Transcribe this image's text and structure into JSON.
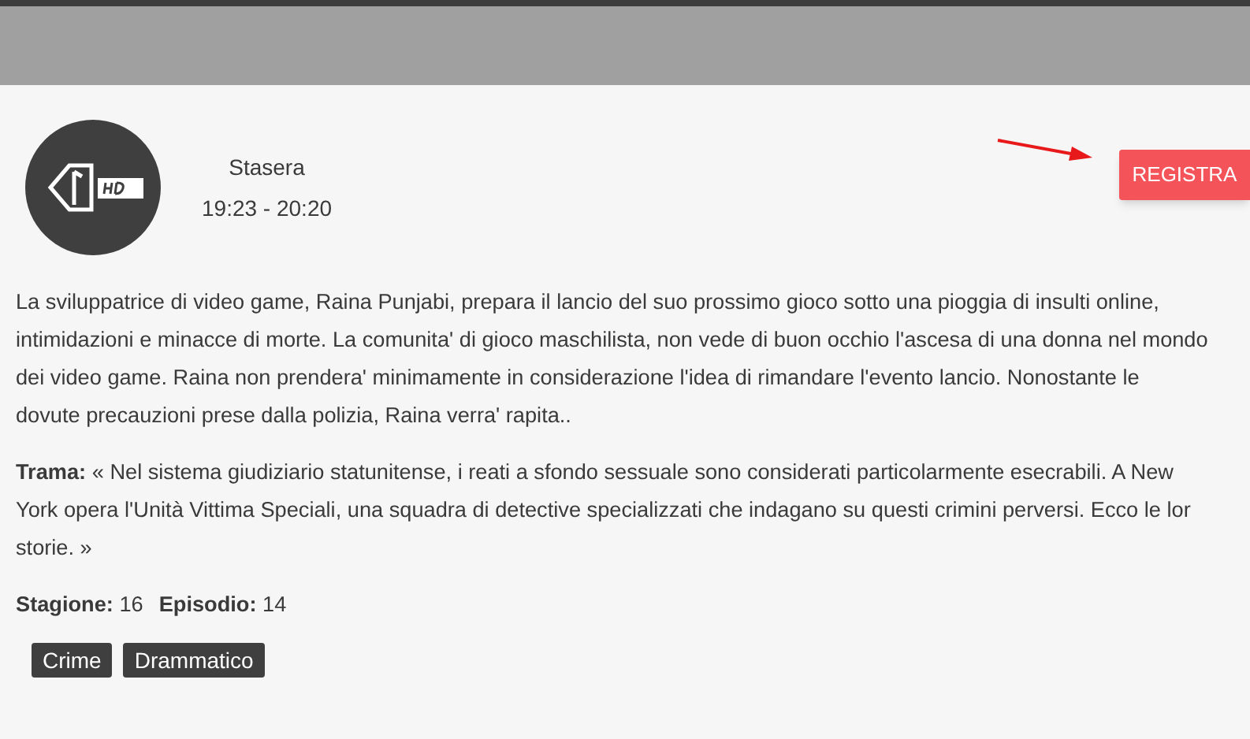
{
  "program": {
    "when": "Stasera",
    "time": "19:23 - 20:20"
  },
  "record_button": {
    "label": "REGISTRA"
  },
  "description": [
    "La sviluppatrice di video game, Raina Punjabi, prepara il lancio del suo prossimo gioco sotto una pioggia di insulti online,",
    "intimidazioni e minacce di morte. La comunita' di gioco maschilista, non vede di buon occhio l'ascesa di una donna nel mondo",
    "dei video game. Raina non prendera' minimamente in considerazione l'idea di rimandare l'evento lancio. Nonostante le",
    "dovute precauzioni prese dalla polizia, Raina verra' rapita.."
  ],
  "plot": [
    "**Trama:** « Nel sistema giudiziario statunitense, i reati a sfondo sessuale sono considerati particolarmente esecrabili. A New",
    "York opera l'Unità Vittima Speciali, una squadra di detective specializzati che indagano su questi crimini perversi. Ecco le lor",
    "storie. »"
  ],
  "details": [
    "**Stagione:** 16",
    "**Episodio:** 14"
  ],
  "genres": [
    "Crime",
    "Drammatico"
  ]
}
